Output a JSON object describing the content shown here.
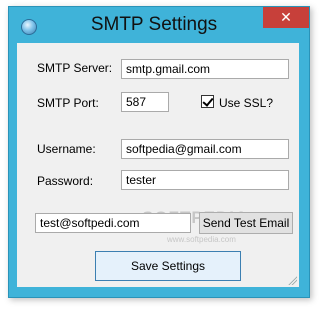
{
  "window": {
    "title": "SMTP Settings",
    "close_label": "✕"
  },
  "form": {
    "server_label": "SMTP Server:",
    "server_value": "smtp.gmail.com",
    "port_label": "SMTP Port:",
    "port_value": "587",
    "ssl_label": "Use SSL?",
    "ssl_checked": true,
    "username_label": "Username:",
    "username_value": "softpedia@gmail.com",
    "password_label": "Password:",
    "password_value": "tester",
    "test_email_value": "test@softpedi.com",
    "send_test_label": "Send Test Email",
    "save_label": "Save Settings"
  },
  "watermark": {
    "logo_text": "SOFTPEDIA",
    "url_text": "www.softpedia.com"
  },
  "colors": {
    "frame": "#3fb3d9",
    "close_button": "#c7403a",
    "client": "#f0f0f0"
  }
}
